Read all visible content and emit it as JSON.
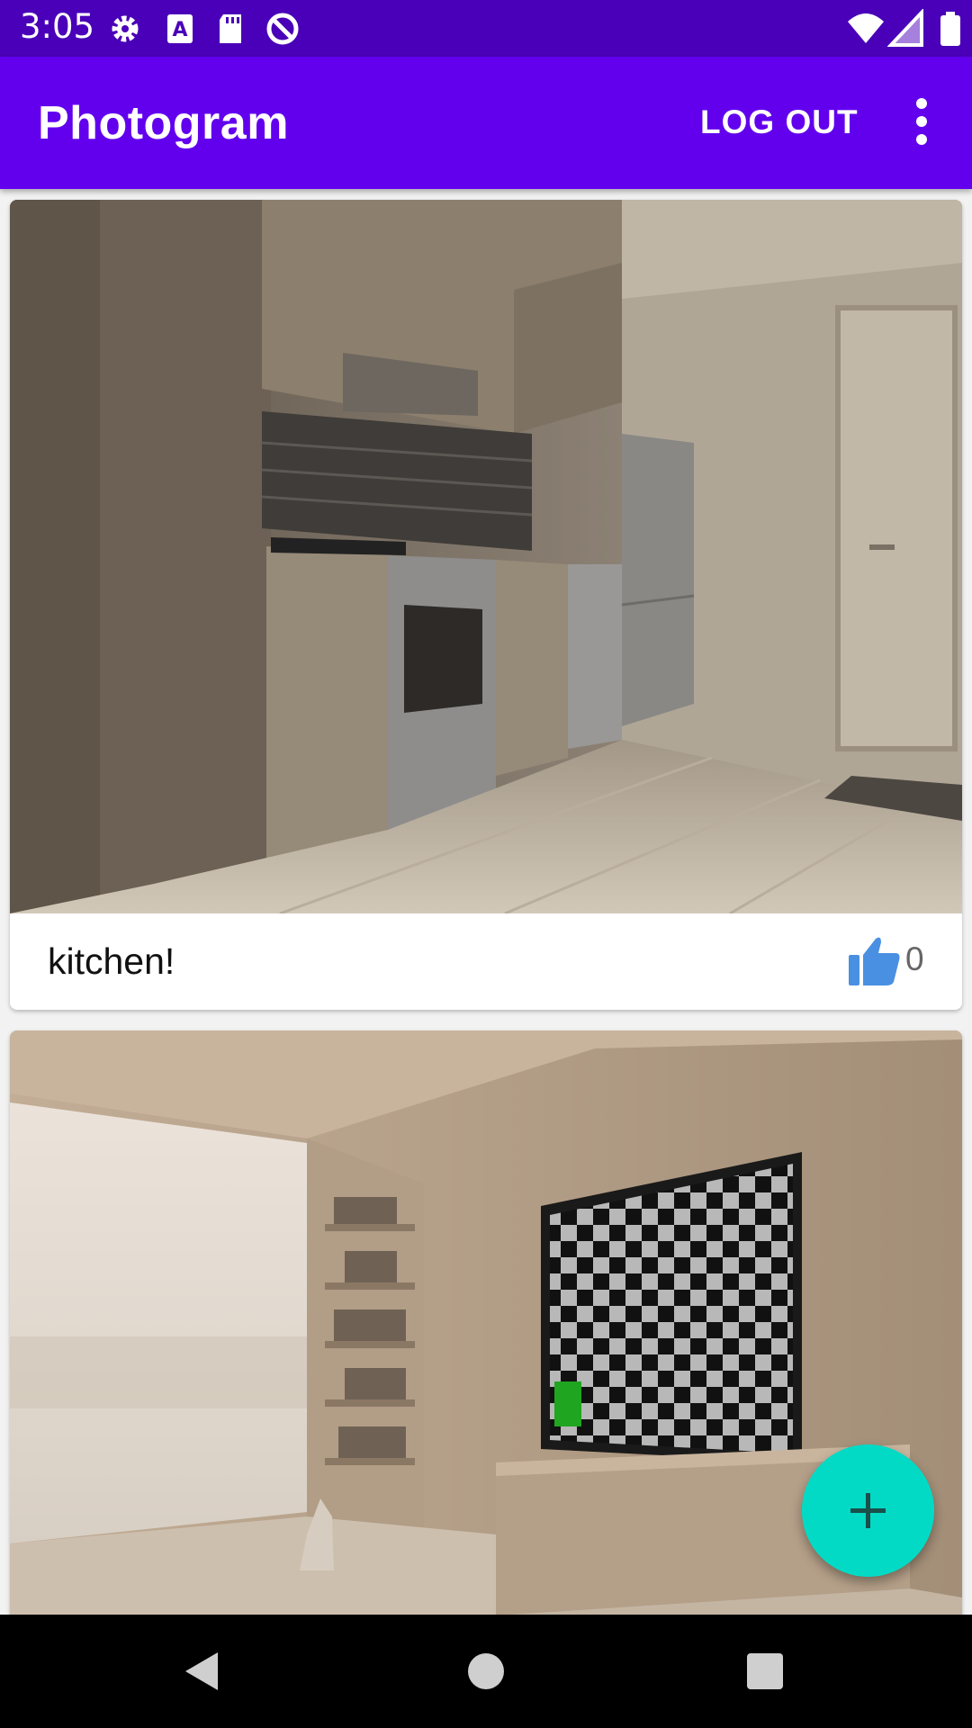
{
  "status_bar": {
    "time": "3:05",
    "left_icons": [
      "gear-icon",
      "keyboard-a-icon",
      "sd-card-icon",
      "no-disturb-icon"
    ],
    "right_icons": [
      "wifi-icon",
      "cell-signal-icon",
      "battery-icon"
    ]
  },
  "app_bar": {
    "title": "Photogram",
    "logout_label": "LOG OUT",
    "overflow_icon": "more-vert-icon",
    "color": "#6200ee"
  },
  "feed": {
    "posts": [
      {
        "caption": "kitchen!",
        "likes": "0",
        "photo": "kitchen interior render",
        "like_icon": "thumbs-up-icon"
      },
      {
        "caption": "",
        "likes": "",
        "photo": "living room with tv render"
      }
    ]
  },
  "fab": {
    "icon": "plus-icon",
    "color": "#03dac5"
  },
  "nav_bar": {
    "icons": [
      "back-icon",
      "home-icon",
      "recents-icon"
    ]
  }
}
